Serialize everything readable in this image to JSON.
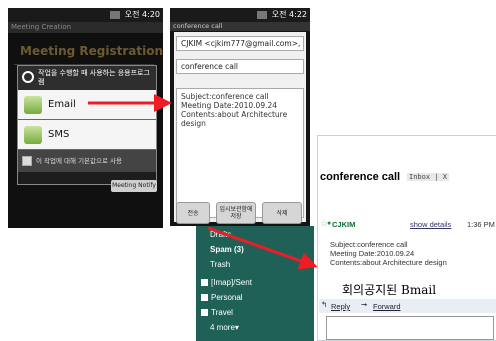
{
  "colors": {
    "arrow": "#ee1c24",
    "gmail_sidebar": "#1f6157",
    "sender_green": "#0a6b30"
  },
  "phone1": {
    "status_time": "오전 4:20",
    "window_title": "Meeting Creation",
    "heading": "Meeting Registration",
    "chooser_title": "작업을 수행할 때 사용하는 응용프로그램",
    "chooser_items": [
      "Email",
      "SMS"
    ],
    "default_check_label": "이 작업에 대해 기본값으로 사용",
    "meeting_button": "Meeting Notify"
  },
  "phone2": {
    "status_time": "오전 4:22",
    "window_title": "conference call",
    "to_field": "CJKIM <cjkim777@gmail.com>,",
    "subject_field": "conference call",
    "body_lines": [
      "Subject:conference call",
      "Meeting Date:2010.09.24",
      "Contents:about Architecture design"
    ],
    "buttons": {
      "send": "전송",
      "save": "임시보관함에 저장",
      "delete": "삭제"
    }
  },
  "gmail_sidebar": {
    "items": [
      "Drafts",
      "Spam (3)",
      "Trash"
    ],
    "labels": [
      "[Imap]/Sent",
      "Personal",
      "Travel"
    ],
    "more": "4 more▾"
  },
  "gmail_message": {
    "subject": "conference call",
    "inbox_chip": "Inbox | X",
    "sender": "CJKIM",
    "show_details": "show details",
    "time": "1:36 PM",
    "body_lines": [
      "Subject:conference call",
      "Meeting Date:2010.09.24",
      "Contents:about Architecture design"
    ],
    "caption": "회의공지된 Bmail",
    "reply": "Reply",
    "forward": "Forward"
  }
}
